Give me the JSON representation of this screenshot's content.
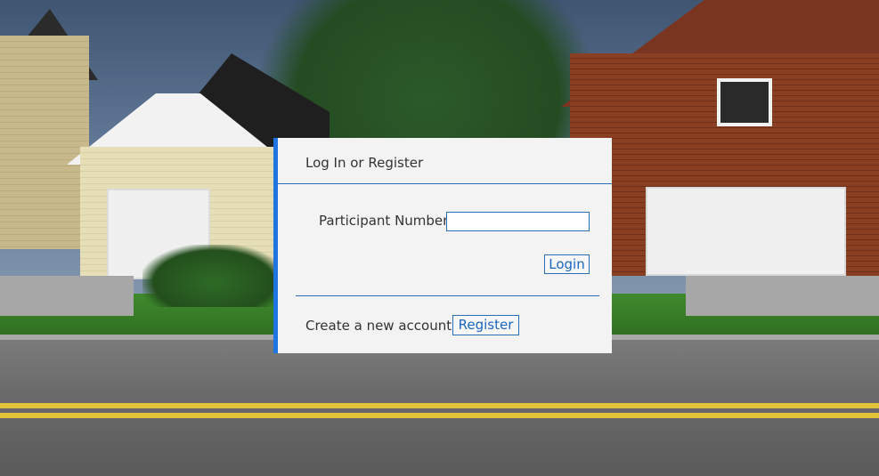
{
  "dialog": {
    "title": "Log In or Register",
    "participant_label": "Participant Number",
    "participant_value": "",
    "login_label": "Login",
    "create_label": "Create a new account:",
    "register_label": "Register"
  },
  "colors": {
    "accent": "#1e74e0",
    "rule": "#2a6db3",
    "dialog_bg": "#f3f3f3"
  }
}
